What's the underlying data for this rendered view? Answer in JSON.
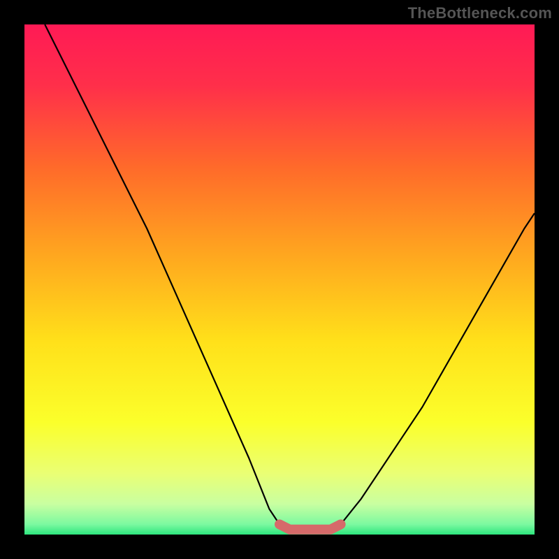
{
  "watermark": "TheBottleneck.com",
  "chart_data": {
    "type": "line",
    "title": "",
    "xlabel": "",
    "ylabel": "",
    "xlim": [
      0,
      100
    ],
    "ylim": [
      0,
      100
    ],
    "grid": false,
    "series": [
      {
        "name": "left-curve",
        "x": [
          4,
          8,
          12,
          16,
          20,
          24,
          28,
          32,
          36,
          40,
          44,
          48,
          50
        ],
        "y": [
          100,
          92,
          84,
          76,
          68,
          60,
          51,
          42,
          33,
          24,
          15,
          5,
          2
        ],
        "color": "#000000"
      },
      {
        "name": "right-curve",
        "x": [
          62,
          66,
          70,
          74,
          78,
          82,
          86,
          90,
          94,
          98,
          100
        ],
        "y": [
          2,
          7,
          13,
          19,
          25,
          32,
          39,
          46,
          53,
          60,
          63
        ],
        "color": "#000000"
      },
      {
        "name": "trough-marker",
        "x": [
          50,
          52,
          54,
          56,
          58,
          60,
          62
        ],
        "y": [
          2,
          1,
          1,
          1,
          1,
          1,
          2
        ],
        "color": "#d66a6a"
      }
    ],
    "gradient_stops": [
      {
        "offset": 0.0,
        "color": "#ff1a55"
      },
      {
        "offset": 0.12,
        "color": "#ff2f4a"
      },
      {
        "offset": 0.28,
        "color": "#ff6a2a"
      },
      {
        "offset": 0.45,
        "color": "#ffa61f"
      },
      {
        "offset": 0.62,
        "color": "#ffe01a"
      },
      {
        "offset": 0.78,
        "color": "#fbff2b"
      },
      {
        "offset": 0.88,
        "color": "#eaff74"
      },
      {
        "offset": 0.94,
        "color": "#c9ffa1"
      },
      {
        "offset": 0.98,
        "color": "#7cf9a0"
      },
      {
        "offset": 1.0,
        "color": "#2de67e"
      }
    ]
  }
}
